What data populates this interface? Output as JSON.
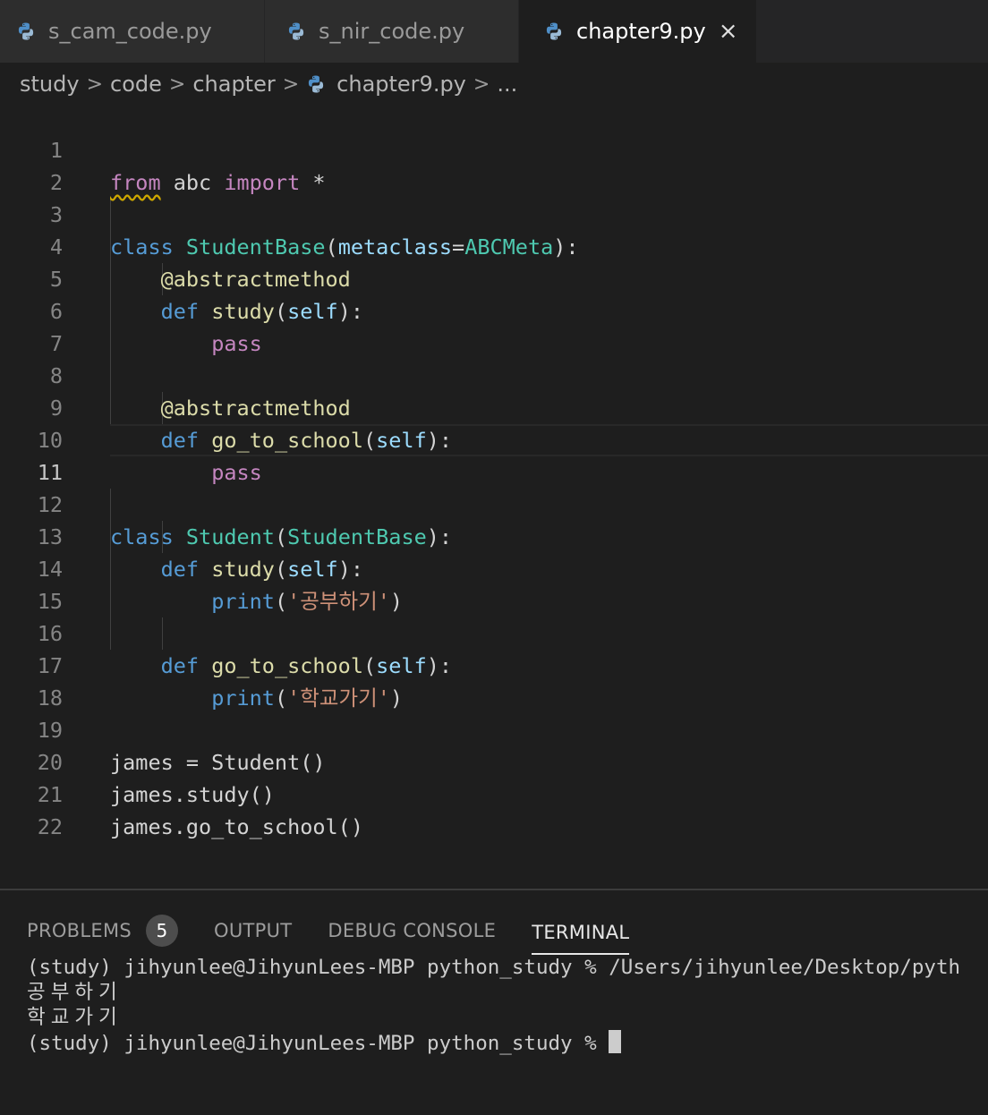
{
  "tabs": [
    {
      "label": "s_cam_code.py",
      "active": false
    },
    {
      "label": "s_nir_code.py",
      "active": false
    },
    {
      "label": "chapter9.py",
      "active": true,
      "close_glyph": "×"
    }
  ],
  "breadcrumb": {
    "items": [
      "study",
      "code",
      "chapter",
      "chapter9.py",
      "..."
    ],
    "separator": ">"
  },
  "editor": {
    "current_line": 11,
    "line_numbers": [
      "1",
      "2",
      "3",
      "4",
      "5",
      "6",
      "7",
      "8",
      "9",
      "10",
      "11",
      "12",
      "13",
      "14",
      "15",
      "16",
      "17",
      "18",
      "19",
      "20",
      "21",
      "22"
    ],
    "tokens": {
      "l1": [
        "from",
        " abc ",
        "import",
        " *"
      ],
      "l3": [
        "class",
        " ",
        "StudentBase",
        "(",
        "metaclass",
        "=",
        "ABCMeta",
        "):"
      ],
      "l4": [
        "@abstractmethod"
      ],
      "l5": [
        "def",
        " ",
        "study",
        "(",
        "self",
        "):"
      ],
      "l6": [
        "pass"
      ],
      "l8": [
        "@abstractmethod"
      ],
      "l9": [
        "def",
        " ",
        "go_to_school",
        "(",
        "self",
        "):"
      ],
      "l10": [
        "pass"
      ],
      "l12": [
        "class",
        " ",
        "Student",
        "(",
        "StudentBase",
        "):"
      ],
      "l13": [
        "def",
        " ",
        "study",
        "(",
        "self",
        "):"
      ],
      "l14": [
        "print",
        "(",
        "'공부하기'",
        ")"
      ],
      "l16": [
        "def",
        " ",
        "go_to_school",
        "(",
        "self",
        "):"
      ],
      "l17": [
        "print",
        "(",
        "'학교가기'",
        ")"
      ],
      "l19": [
        "james = Student()"
      ],
      "l20": [
        "james.study()"
      ],
      "l21": [
        "james.go_to_school()"
      ]
    }
  },
  "panel": {
    "tabs": [
      {
        "label": "PROBLEMS",
        "badge": "5",
        "active": false
      },
      {
        "label": "OUTPUT",
        "active": false
      },
      {
        "label": "DEBUG CONSOLE",
        "active": false
      },
      {
        "label": "TERMINAL",
        "active": true
      }
    ],
    "terminal_lines": [
      "(study) jihyunlee@JihyunLees-MBP python_study % /Users/jihyunlee/Desktop/pyth",
      "공부하기",
      "학교가기",
      "(study) jihyunlee@JihyunLees-MBP python_study % "
    ]
  },
  "colors": {
    "keyword": "#569cd6",
    "control_keyword": "#c586c0",
    "class_name": "#4ec9b0",
    "function": "#dcdcaa",
    "parameter": "#9cdcfe",
    "string": "#ce9178",
    "background": "#1e1e1e"
  },
  "icons": {
    "file_icon": "python-icon",
    "tab_close": "close-icon",
    "breadcrumb_separator": "chevron-right-icon"
  }
}
